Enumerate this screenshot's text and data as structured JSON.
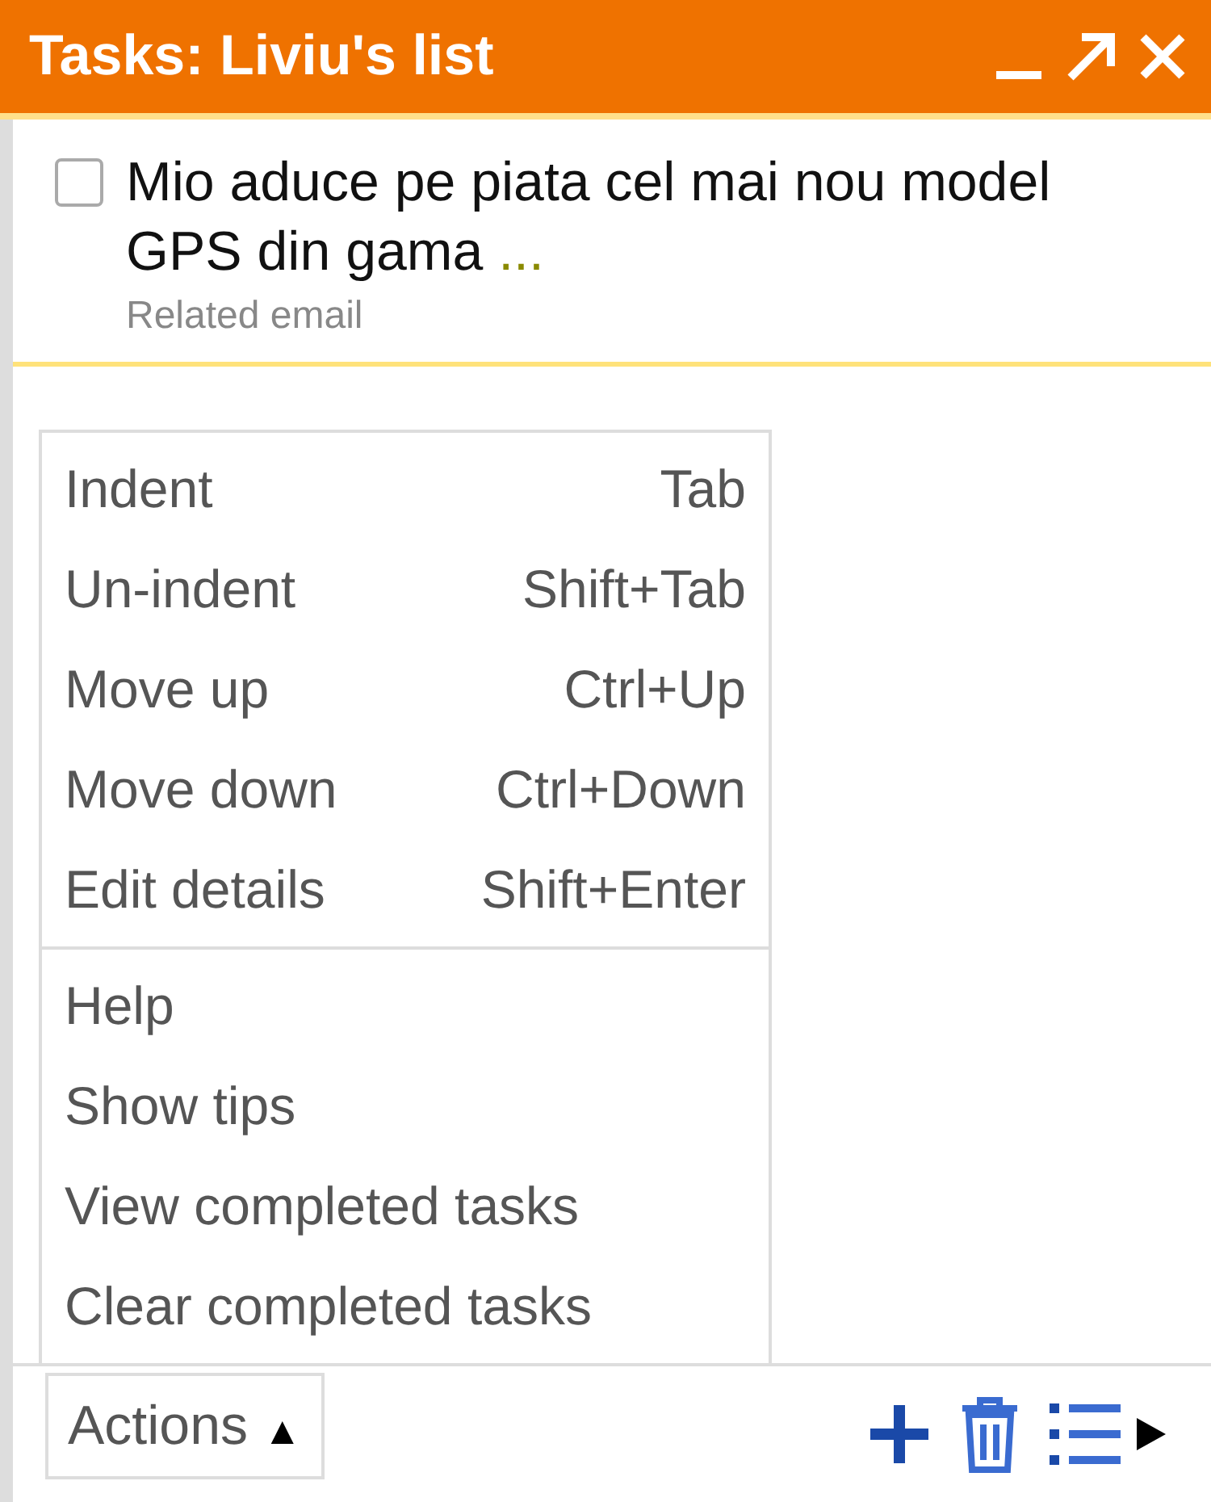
{
  "window": {
    "title": "Tasks: Liviu's list"
  },
  "tasks": [
    {
      "text": "Mio aduce pe piata cel mai nou model GPS din gama",
      "ellipsis": "...",
      "checked": false,
      "note": "Related email"
    }
  ],
  "menu": {
    "sections": [
      [
        {
          "label": "Indent",
          "shortcut": "Tab"
        },
        {
          "label": "Un-indent",
          "shortcut": "Shift+Tab"
        },
        {
          "label": "Move up",
          "shortcut": "Ctrl+Up"
        },
        {
          "label": "Move down",
          "shortcut": "Ctrl+Down"
        },
        {
          "label": "Edit details",
          "shortcut": "Shift+Enter"
        }
      ],
      [
        {
          "label": "Help"
        },
        {
          "label": "Show tips"
        },
        {
          "label": "View completed tasks"
        },
        {
          "label": "Clear completed tasks"
        }
      ]
    ]
  },
  "footer": {
    "actions_button": {
      "label": "Actions",
      "caret": "▲"
    }
  }
}
